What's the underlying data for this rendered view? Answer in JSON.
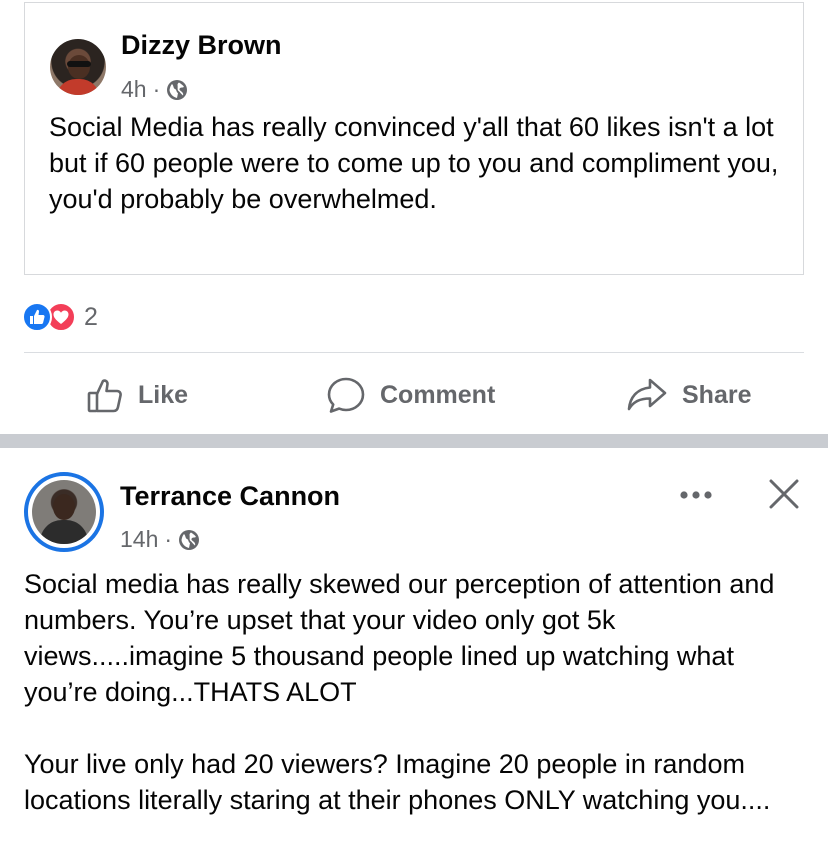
{
  "shared_post": {
    "author": "Dizzy Brown",
    "time": "4h",
    "separator": "·",
    "privacy_icon": "globe-icon",
    "text": "Social Media has really convinced y'all that 60 likes isn't a lot but if 60 people were to come up to you and compliment you, you'd probably be overwhelmed."
  },
  "reactions": {
    "icons": [
      "like-reaction-icon",
      "love-reaction-icon"
    ],
    "count": "2",
    "like_color": "#1877f2",
    "love_color": "#f33e58"
  },
  "actions": {
    "like": "Like",
    "comment": "Comment",
    "share": "Share"
  },
  "post": {
    "author": "Terrance Cannon",
    "time": "14h",
    "separator": "·",
    "privacy_icon": "globe-icon",
    "paragraph1": "Social media has really skewed our perception of attention and numbers. You’re upset that your video only got 5k views.....imagine 5 thousand people lined up watching what you’re doing...THATS ALOT",
    "paragraph2": "Your live only had 20 viewers? Imagine 20 people in random locations literally staring at their phones ONLY watching you....",
    "more_icon": "more-options-icon",
    "close_icon": "close-icon",
    "story_ring_color": "#1b74e4"
  },
  "colors": {
    "text_primary": "#050505",
    "text_secondary": "#65676b",
    "divider": "#dadde1",
    "feed_separator": "#c9ccd1"
  }
}
